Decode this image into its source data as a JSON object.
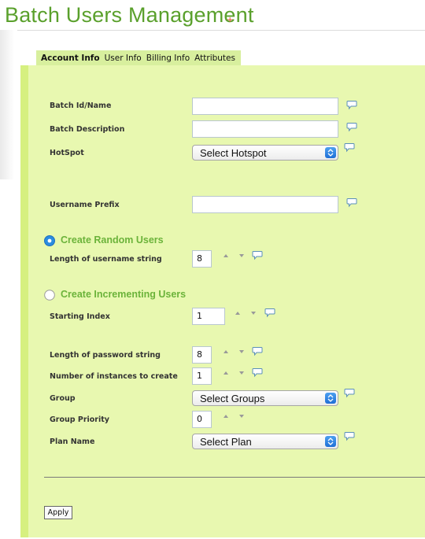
{
  "page": {
    "title": "Batch Users Management",
    "title_marker": "+"
  },
  "tabs": [
    {
      "label": "Account Info",
      "active": true
    },
    {
      "label": "User Info",
      "active": false
    },
    {
      "label": "Billing Info",
      "active": false
    },
    {
      "label": "Attributes",
      "active": false
    }
  ],
  "form": {
    "batch_id": {
      "label": "Batch Id/Name",
      "value": ""
    },
    "batch_description": {
      "label": "Batch Description",
      "value": ""
    },
    "hotspot": {
      "label": "HotSpot",
      "selected": "Select Hotspot"
    },
    "username_prefix": {
      "label": "Username Prefix",
      "value": ""
    },
    "create_random": {
      "label": "Create Random Users",
      "checked": true
    },
    "username_length": {
      "label": "Length of username string",
      "value": "8"
    },
    "create_incrementing": {
      "label": "Create Incrementing Users",
      "checked": false
    },
    "starting_index": {
      "label": "Starting Index",
      "value": "1"
    },
    "password_length": {
      "label": "Length of password string",
      "value": "8"
    },
    "instances": {
      "label": "Number of instances to create",
      "value": "1"
    },
    "group": {
      "label": "Group",
      "selected": "Select Groups"
    },
    "group_priority": {
      "label": "Group Priority",
      "value": "0"
    },
    "plan_name": {
      "label": "Plan Name",
      "selected": "Select Plan"
    }
  },
  "actions": {
    "apply_label": "Apply"
  },
  "colors": {
    "title_green": "#5aa02c",
    "panel_bg": "#e8f8b0",
    "tab_bg": "#d8ef9e",
    "radio_selected": "#2a8de0",
    "select_arrow": "#1f6fd6"
  },
  "icons": {
    "help": "speech-bubble-icon",
    "spin_up": "triangle-up-icon",
    "spin_down": "triangle-down-icon",
    "select_arrow": "updown-chevron-icon"
  }
}
